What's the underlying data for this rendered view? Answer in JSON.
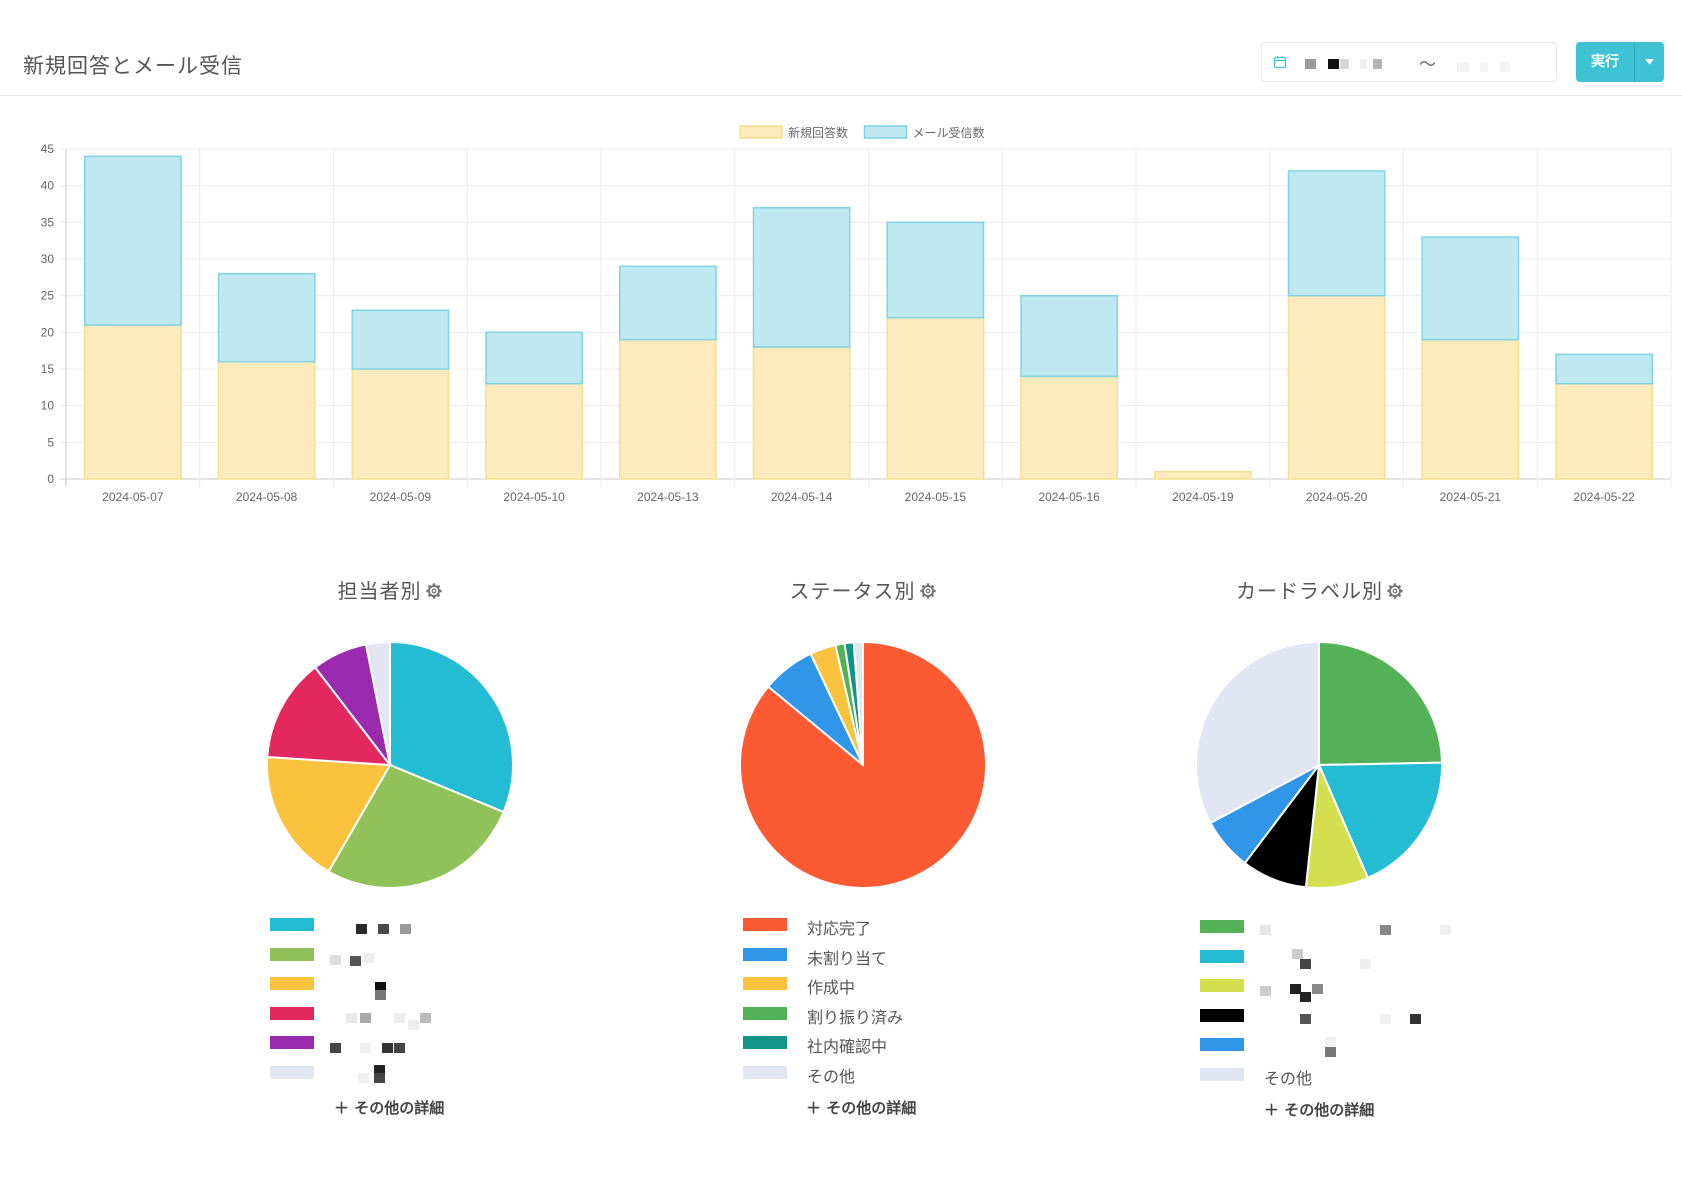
{
  "header": {
    "title": "新規回答とメール受信",
    "date_separator": "〜",
    "run_label": "実行"
  },
  "colors": {
    "accent": "#3fc3d4",
    "new_responses": "#fdebbe",
    "mail_received": "#bfe8f1"
  },
  "chart_data": [
    {
      "type": "bar",
      "stacked": true,
      "title": "",
      "legend_position": "top",
      "categories": [
        "2024-05-07",
        "2024-05-08",
        "2024-05-09",
        "2024-05-10",
        "2024-05-13",
        "2024-05-14",
        "2024-05-15",
        "2024-05-16",
        "2024-05-19",
        "2024-05-20",
        "2024-05-21",
        "2024-05-22"
      ],
      "series": [
        {
          "name": "新規回答数",
          "color": "#fdebbe",
          "stroke": "#f6df8e",
          "values": [
            21,
            16,
            15,
            13,
            19,
            18,
            22,
            14,
            1,
            25,
            19,
            13
          ]
        },
        {
          "name": "メール受信数",
          "color": "#bfe8f1",
          "stroke": "#7fd3e4",
          "values": [
            23,
            12,
            8,
            7,
            10,
            19,
            13,
            11,
            0,
            17,
            14,
            4
          ]
        }
      ],
      "ylim": [
        0,
        45
      ],
      "yticks": [
        0,
        5,
        10,
        15,
        20,
        25,
        30,
        35,
        40,
        45
      ],
      "grid": true
    },
    {
      "type": "pie",
      "title": "担当者別",
      "slices": [
        {
          "label": "",
          "value": 30,
          "color": "#24bcd3"
        },
        {
          "label": "",
          "value": 26,
          "color": "#91c25a"
        },
        {
          "label": "",
          "value": 17,
          "color": "#fbc23e"
        },
        {
          "label": "",
          "value": 13,
          "color": "#e2285f"
        },
        {
          "label": "",
          "value": 7,
          "color": "#9a2bae"
        },
        {
          "label": "",
          "value": 3,
          "color": "#e1e6f2"
        }
      ]
    },
    {
      "type": "pie",
      "title": "ステータス別",
      "slices": [
        {
          "label": "対応完了",
          "value": 86,
          "color": "#fd5a34"
        },
        {
          "label": "未割り当て",
          "value": 7,
          "color": "#2f96ea"
        },
        {
          "label": "作成中",
          "value": 3.4,
          "color": "#fbc23e"
        },
        {
          "label": "割り振り済み",
          "value": 1.2,
          "color": "#53b257"
        },
        {
          "label": "社内確認中",
          "value": 1.2,
          "color": "#13948a"
        },
        {
          "label": "その他",
          "value": 1.2,
          "color": "#e1e6f2"
        }
      ]
    },
    {
      "type": "pie",
      "title": "カードラベル別",
      "slices": [
        {
          "label": "",
          "value": 24.7,
          "color": "#53b257"
        },
        {
          "label": "",
          "value": 18.8,
          "color": "#24bcd3"
        },
        {
          "label": "",
          "value": 8.2,
          "color": "#d4df4f"
        },
        {
          "label": "",
          "value": 8.6,
          "color": "#000000"
        },
        {
          "label": "",
          "value": 6.9,
          "color": "#2f96ea"
        },
        {
          "label": "その他",
          "value": 32.8,
          "color": "#e1e6f2"
        }
      ]
    }
  ],
  "pie_more_link": "＋ その他の詳細"
}
